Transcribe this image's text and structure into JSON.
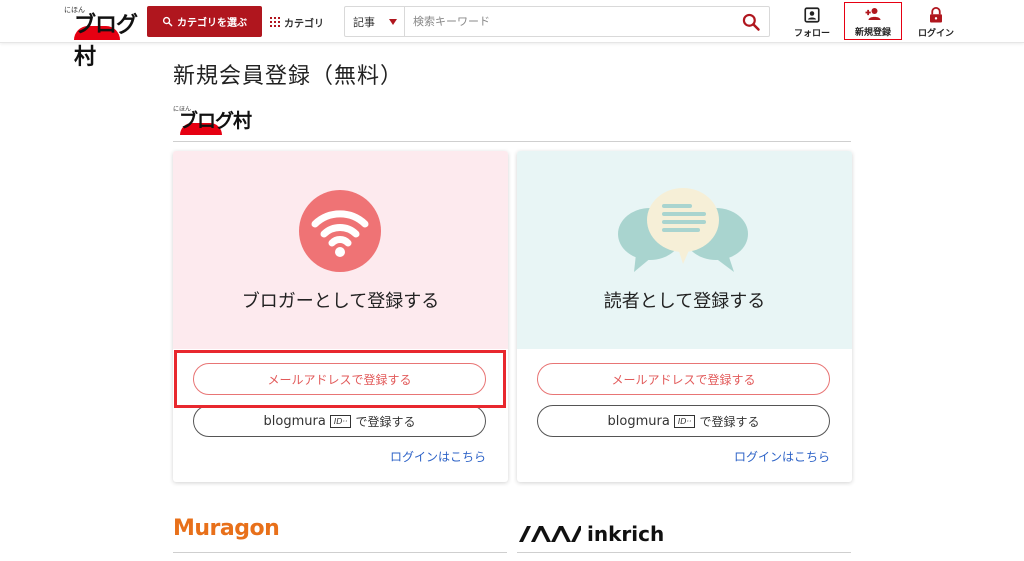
{
  "header": {
    "logo": {
      "small_text": "にほん",
      "main_text": "ブログ村"
    },
    "category_select_label": "カテゴリを選ぶ",
    "category_link_label": "カテゴリ",
    "search": {
      "type_value": "記事",
      "placeholder": "検索キーワード"
    },
    "nav": {
      "follow_label": "フォロー",
      "signup_label": "新規登録",
      "login_label": "ログイン"
    }
  },
  "main": {
    "page_title": "新規会員登録（無料）",
    "sub_logo": {
      "small_text": "にほん",
      "main_text": "ブログ村"
    },
    "cards": [
      {
        "title": "ブロガーとして登録する",
        "email_button": "メールアドレスで登録する",
        "blogmura_brand": "blogmura",
        "blogmura_badge": "ID··",
        "blogmura_suffix": "で登録する",
        "login_link": "ログインはこちら"
      },
      {
        "title": "読者として登録する",
        "email_button": "メールアドレスで登録する",
        "blogmura_brand": "blogmura",
        "blogmura_badge": "ID··",
        "blogmura_suffix": "で登録する",
        "login_link": "ログインはこちら"
      }
    ],
    "partners": {
      "muragon": "Muragon",
      "inkrich": "inkrich"
    }
  },
  "colors": {
    "brand_red": "#b0161e",
    "accent_red": "#e60012",
    "blogger_bg": "#fdeaee",
    "reader_bg": "#e8f5f5",
    "wifi_circle": "#ef7375",
    "link_blue": "#2e63c7",
    "muragon_orange": "#e8701a",
    "highlight": "#e8282e"
  },
  "icons": {
    "search": "search-icon",
    "grid": "grid-icon",
    "follow": "person-card-icon",
    "signup": "add-person-icon",
    "login": "lock-icon",
    "blogger": "wifi-icon",
    "reader": "chat-bubbles-icon"
  }
}
